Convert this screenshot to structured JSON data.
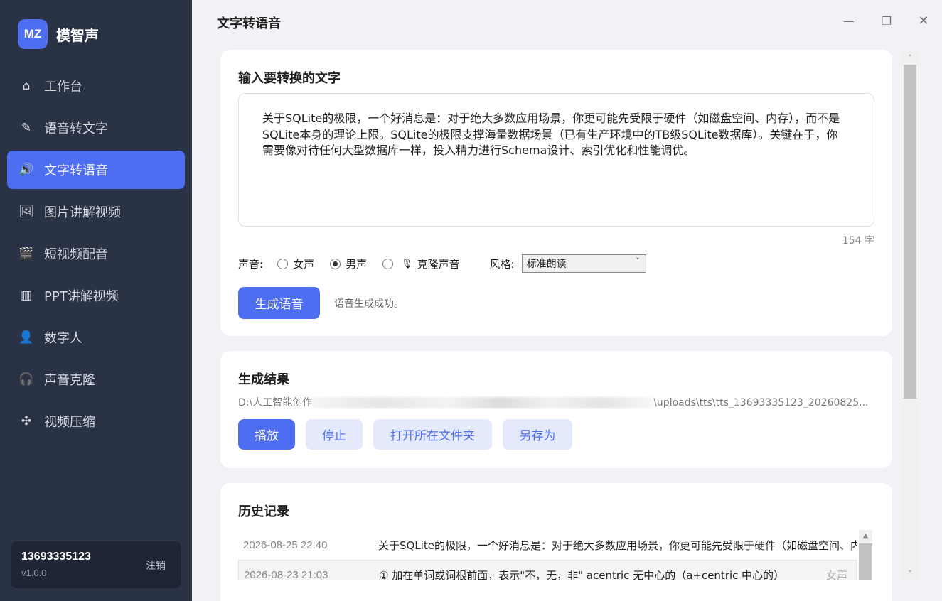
{
  "app": {
    "logo": "MZ",
    "name": "模智声"
  },
  "nav": [
    {
      "label": "工作台",
      "icon": "⌂",
      "name": "nav-workbench",
      "icon_name": "home-icon"
    },
    {
      "label": "语音转文字",
      "icon": "✎",
      "name": "nav-speech-to-text",
      "icon_name": "pen-icon"
    },
    {
      "label": "文字转语音",
      "icon": "🔊",
      "name": "nav-text-to-speech",
      "icon_name": "speaker-icon",
      "active": true
    },
    {
      "label": "图片讲解视频",
      "icon": "🖼",
      "name": "nav-image-video",
      "icon_name": "image-icon"
    },
    {
      "label": "短视频配音",
      "icon": "🎬",
      "name": "nav-short-video-dub",
      "icon_name": "clapper-icon"
    },
    {
      "label": "PPT讲解视频",
      "icon": "▥",
      "name": "nav-ppt-video",
      "icon_name": "presentation-icon"
    },
    {
      "label": "数字人",
      "icon": "👤",
      "name": "nav-digital-human",
      "icon_name": "person-icon"
    },
    {
      "label": "声音克隆",
      "icon": "🎧",
      "name": "nav-voice-clone",
      "icon_name": "headphones-icon"
    },
    {
      "label": "视频压缩",
      "icon": "✣",
      "name": "nav-video-compress",
      "icon_name": "compress-icon"
    }
  ],
  "user": {
    "id": "13693335123",
    "version": "v1.0.0",
    "logout": "注销"
  },
  "page_title": "文字转语音",
  "window": {
    "minimize": "—",
    "maximize": "❐",
    "close": "✕"
  },
  "input_card": {
    "title": "输入要转换的文字",
    "text": "关于SQLite的极限，一个好消息是：对于绝大多数应用场景，你更可能先受限于硬件（如磁盘空间、内存），而不是SQLite本身的理论上限。SQLite的极限支撑海量数据场景（已有生产环境中的TB级SQLite数据库）。关键在于，你需要像对待任何大型数据库一样，投入精力进行Schema设计、索引优化和性能调优。",
    "char_count": "154 字",
    "voice_label": "声音:",
    "voices": [
      {
        "label": "女声",
        "checked": false
      },
      {
        "label": "男声",
        "checked": true
      },
      {
        "label": "克隆声音",
        "checked": false,
        "icon": "🎙"
      }
    ],
    "style_label": "风格:",
    "style_value": "标准朗读",
    "generate_button": "生成语音",
    "status": "语音生成成功。"
  },
  "result_card": {
    "title": "生成结果",
    "path_prefix": "D:\\人工智能创作",
    "path_suffix": "\\uploads\\tts\\tts_13693335123_20260825...",
    "buttons": {
      "play": "播放",
      "stop": "停止",
      "open_folder": "打开所在文件夹",
      "save_as": "另存为"
    }
  },
  "history_card": {
    "title": "历史记录",
    "rows": [
      {
        "time": "2026-08-25 22:40",
        "text": "关于SQLite的极限，一个好消息是：对于绝大多数应用场景，你更可能先受限于硬件（如磁盘空间、内存），而不是",
        "tag": ""
      },
      {
        "time": "2026-08-23 21:03",
        "text": "① 加在单词或词根前面，表示\"不，无，非\" acentric 无中心的（a+centric 中心的）",
        "tag": "女声"
      }
    ]
  }
}
